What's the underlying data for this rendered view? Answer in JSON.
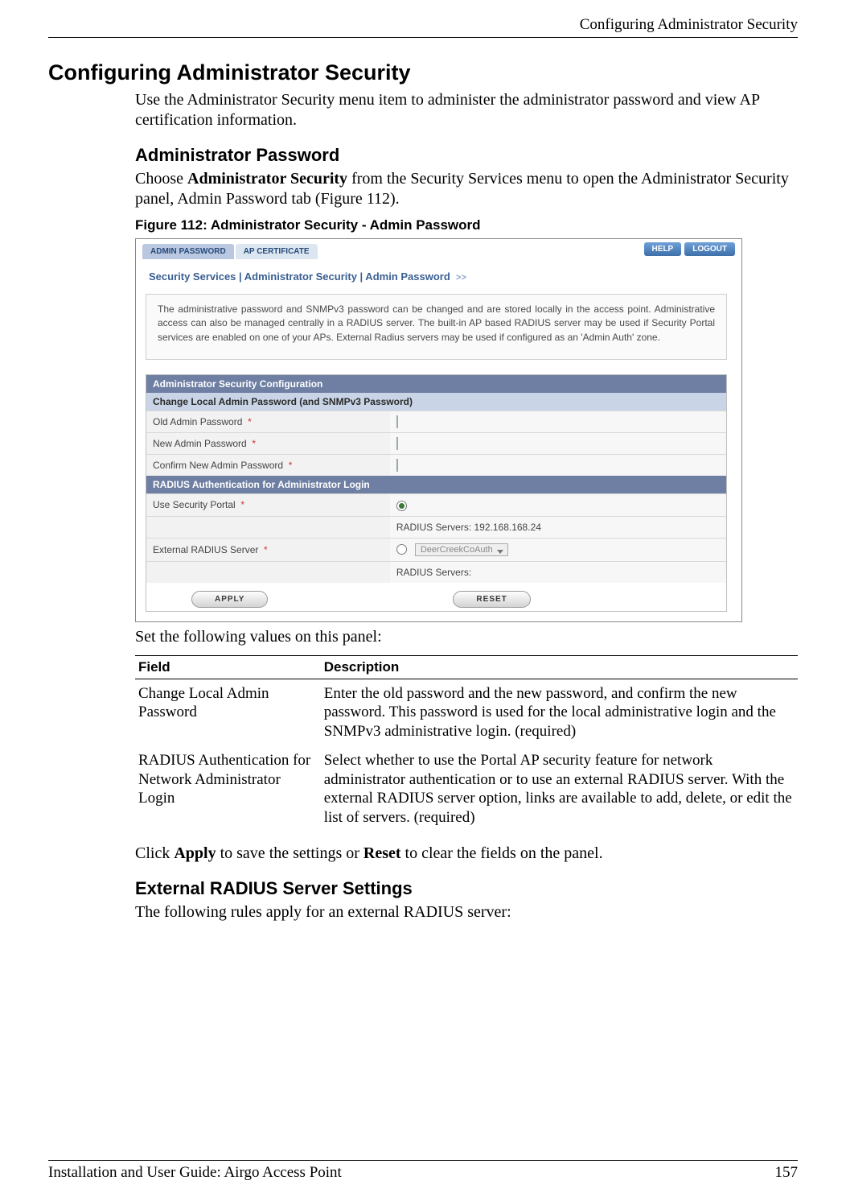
{
  "header": {
    "running": "Configuring Administrator Security"
  },
  "h1": "Configuring Administrator Security",
  "intro": "Use the Administrator Security menu item to administer the administrator password and view AP certification information.",
  "sect1": {
    "title": "Administrator Password",
    "lead_pre": "Choose ",
    "lead_bold": "Administrator Security",
    "lead_post": " from the Security Services menu to open the Administrator Security panel, Admin Password tab (Figure 112).",
    "figcaption": "Figure 112:    Administrator Security - Admin Password"
  },
  "fig": {
    "tabs": {
      "active": "ADMIN PASSWORD",
      "other": "AP CERTIFICATE"
    },
    "buttons": {
      "help": "HELP",
      "logout": "LOGOUT"
    },
    "breadcrumb": "Security Services | Administrator Security | Admin Password",
    "bc_arrow": ">>",
    "info": "The administrative password and SNMPv3 password can be changed and are stored locally in the access point. Administrative access can also be managed centrally in a RADIUS server. The built-in AP based RADIUS server may be used if Security Portal services are enabled on one of your APs. External Radius servers may be used if configured as an 'Admin Auth' zone.",
    "hdr1": "Administrator Security Configuration",
    "hdr2": "Change Local Admin Password (and SNMPv3 Password)",
    "row_old": "Old Admin Password",
    "row_new": "New Admin Password",
    "row_cfm": "Confirm New Admin Password",
    "hdr3": "RADIUS Authentication for Administrator Login",
    "row_portal": "Use Security Portal",
    "row_servers1": "RADIUS Servers:  192.168.168.24",
    "row_ext": "External RADIUS Server",
    "ext_select": "DeerCreekCoAuth",
    "row_servers2": "RADIUS Servers:",
    "asterisk": "*",
    "apply": "APPLY",
    "reset": "RESET"
  },
  "after_fig": "Set the following values on this panel:",
  "defs": {
    "th_field": "Field",
    "th_desc": "Description",
    "rows": [
      {
        "field": "Change Local Admin Password",
        "desc": "Enter the old password and the new password, and confirm the new password. This password is used for the local administrative login and the SNMPv3 administrative login. (required)"
      },
      {
        "field": "RADIUS Authentication for Network Administrator Login",
        "desc": "Select whether to use the Portal AP security feature for network administrator authentication or to use an external RADIUS server. With the external RADIUS server option, links are available to add, delete, or edit the list of servers. (required)"
      }
    ]
  },
  "apply_sentence": {
    "pre": "Click ",
    "b1": "Apply",
    "mid": " to save the settings or ",
    "b2": "Reset",
    "post": " to clear the fields on the panel."
  },
  "sect2": {
    "title": "External RADIUS Server Settings",
    "lead": "The following rules apply for an external RADIUS server:"
  },
  "footer": {
    "left": "Installation and User Guide: Airgo Access Point",
    "right": "157"
  }
}
